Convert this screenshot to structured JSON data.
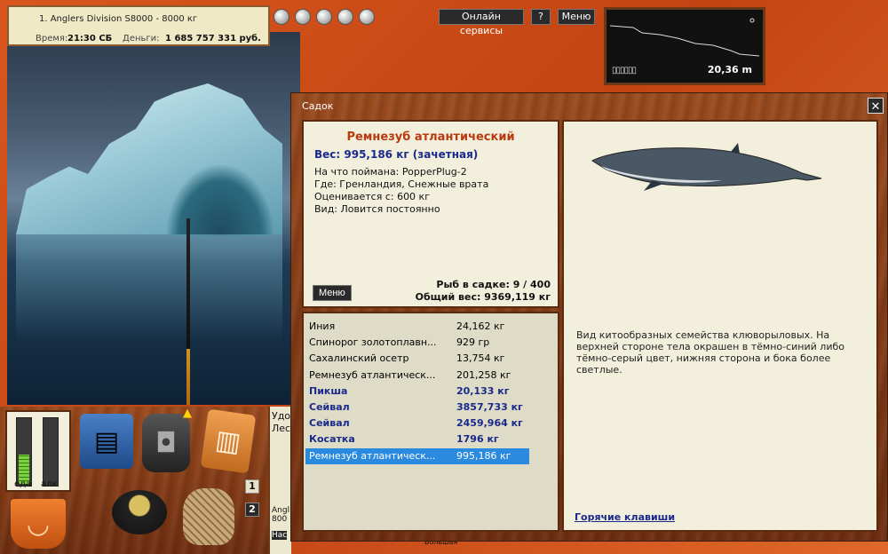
{
  "info": {
    "division": "1. Anglers Division S8000 - 8000 кг",
    "time_label": "Время:",
    "time_value": "21:30 СБ",
    "money_label": "Деньги:",
    "money_value": "1 685 757 331 руб."
  },
  "topbar": {
    "online_services": "Онлайн сервисы",
    "help": "?",
    "menu": "Меню"
  },
  "depth": {
    "value": "20,36 m",
    "battery": "▯▯▯▯▯▯"
  },
  "meters": {
    "food_label": "еда",
    "alcohol_label": "алк",
    "food_level": 0.45,
    "alcohol_level": 0.0
  },
  "badges": {
    "one": "1",
    "two": "2"
  },
  "partial": {
    "udo": "Удо",
    "les": "Лес",
    "angl": "Angl",
    "num": "800",
    "nas": "Нас",
    "bolsh": "Большая"
  },
  "dialog": {
    "title": "Садок",
    "close": "✕",
    "fish": {
      "name": "Ремнезуб атлантический",
      "weight": "Вес: 995,186 кг (зачетная)",
      "caught_with": "На что поймана: PopperPlug-2",
      "where": "Где: Гренландия, Снежные врата",
      "valued_from": "Оценивается с: 600 кг",
      "kind": "Вид: Ловится постоянно"
    },
    "menu": "Меню",
    "fish_count": "Рыб в садке: 9 / 400",
    "total_weight": "Общий вес: 9369,119 кг",
    "list": [
      {
        "name": "Иния",
        "weight": "24,162 кг",
        "bold": false,
        "selected": false
      },
      {
        "name": "Спинорог золотоплавн...",
        "weight": "929 гр",
        "bold": false,
        "selected": false
      },
      {
        "name": "Сахалинский осетр",
        "weight": "13,754 кг",
        "bold": false,
        "selected": false
      },
      {
        "name": "Ремнезуб атлантическ...",
        "weight": "201,258 кг",
        "bold": false,
        "selected": false
      },
      {
        "name": "Пикша",
        "weight": "20,133 кг",
        "bold": true,
        "selected": false
      },
      {
        "name": "Сейвал",
        "weight": "3857,733 кг",
        "bold": true,
        "selected": false
      },
      {
        "name": "Сейвал",
        "weight": "2459,964 кг",
        "bold": true,
        "selected": false
      },
      {
        "name": "Косатка",
        "weight": "1796 кг",
        "bold": true,
        "selected": false
      },
      {
        "name": "Ремнезуб атлантическ...",
        "weight": "995,186 кг",
        "bold": false,
        "selected": true
      }
    ],
    "description": "Вид китообразных семейства клюворыловых. На верхней стороне тела окрашен в тёмно-синий либо тёмно-серый цвет, нижняя сторона и бока более светлые.",
    "hotkeys": "Горячие клавиши"
  },
  "icons": {
    "inventory": [
      "tackle-box-icon",
      "backpack-icon",
      "notebook-icon",
      "bucket-icon",
      "cauldron-icon",
      "net-bag-icon"
    ],
    "warning": "warning-icon"
  }
}
